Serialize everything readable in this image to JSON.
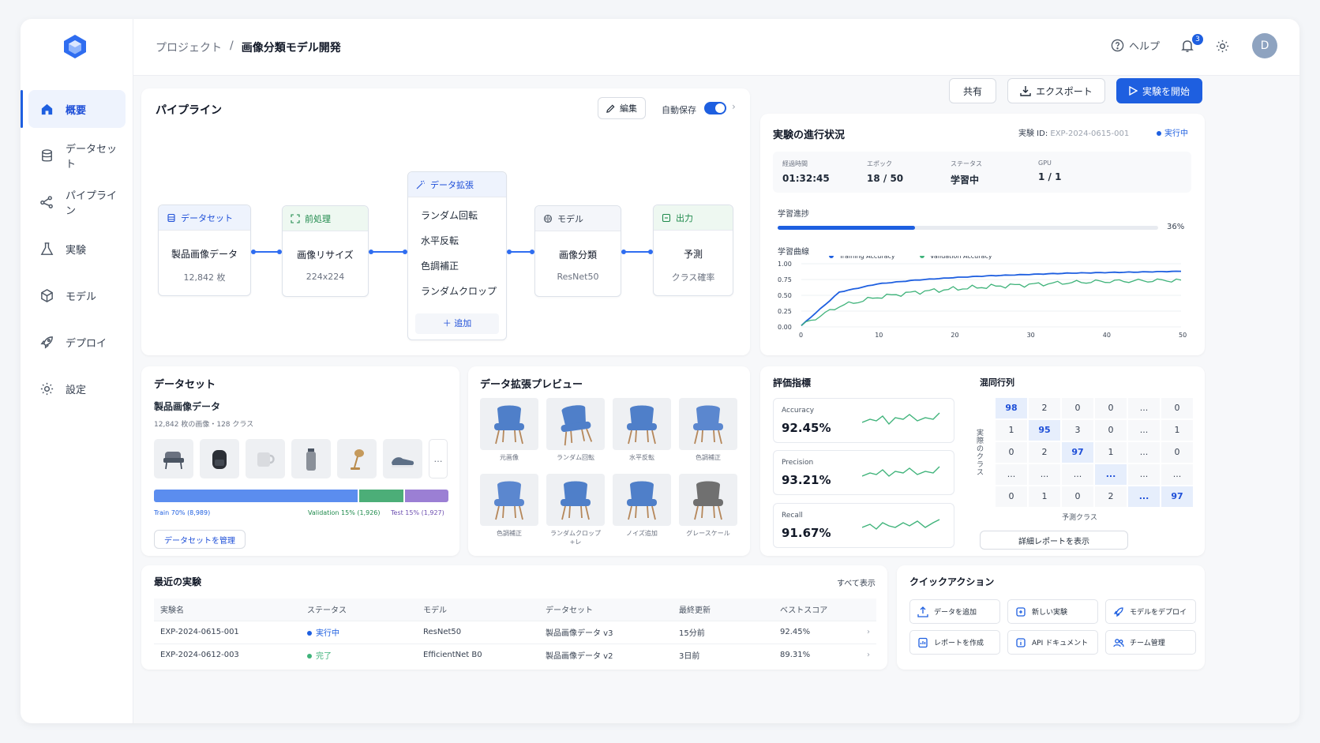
{
  "sidebar": {
    "items": [
      {
        "label": "概要"
      },
      {
        "label": "データセット"
      },
      {
        "label": "パイプライン"
      },
      {
        "label": "実験"
      },
      {
        "label": "モデル"
      },
      {
        "label": "デプロイ"
      },
      {
        "label": "設定"
      }
    ]
  },
  "header": {
    "breadcrumb_root": "プロジェクト",
    "breadcrumb_sep": "/",
    "breadcrumb_current": "画像分類モデル開発",
    "help": "ヘルプ",
    "notif_count": "3",
    "avatar": "D"
  },
  "actions": {
    "share": "共有",
    "export": "エクスポート",
    "start": "実験を開始"
  },
  "pipeline": {
    "title": "パイプライン",
    "edit": "編集",
    "autosave": "自動保存",
    "autosave_on": true,
    "nodes": {
      "dataset": {
        "head": "データセット",
        "title": "製品画像データ",
        "sub": "12,842 枚"
      },
      "preprocess": {
        "head": "前処理",
        "title": "画像リサイズ",
        "sub": "224x224"
      },
      "augment": {
        "head": "データ拡張",
        "items": [
          "ランダム回転",
          "水平反転",
          "色調補正",
          "ランダムクロップ"
        ],
        "add": "＋ 追加"
      },
      "model": {
        "head": "モデル",
        "title": "画像分類",
        "sub": "ResNet50"
      },
      "output": {
        "head": "出力",
        "title": "予測",
        "sub": "クラス確率"
      }
    }
  },
  "progress": {
    "title": "実験の進行状況",
    "exp_label": "実験 ID:",
    "exp_id": "EXP-2024-0615-001",
    "status": "実行中",
    "stats": [
      {
        "label": "経過時間",
        "value": "01:32:45"
      },
      {
        "label": "エポック",
        "value": "18 / 50"
      },
      {
        "label": "ステータス",
        "value": "学習中"
      },
      {
        "label": "GPU",
        "value": "1 / 1"
      }
    ],
    "progress_label": "学習進捗",
    "progress_pct": "36%",
    "progress_value": 0.36,
    "curve_label": "学習曲線"
  },
  "chart_data": {
    "type": "line",
    "x": [
      0,
      5,
      10,
      15,
      20,
      25,
      30,
      35,
      40,
      45,
      50
    ],
    "xlim": [
      0,
      50
    ],
    "ylim": [
      0,
      1
    ],
    "xticks": [
      "0",
      "10",
      "20",
      "30",
      "40",
      "50"
    ],
    "yticks": [
      "1.00",
      "0.75",
      "0.50",
      "0.25",
      "0.00"
    ],
    "series": [
      {
        "name": "Training Accuracy",
        "color": "#1e5fe0",
        "values": [
          0.02,
          0.55,
          0.68,
          0.74,
          0.78,
          0.81,
          0.83,
          0.85,
          0.86,
          0.87,
          0.88
        ]
      },
      {
        "name": "Validation Accuracy",
        "color": "#3fb37a",
        "values": [
          0.02,
          0.33,
          0.47,
          0.55,
          0.6,
          0.64,
          0.67,
          0.7,
          0.72,
          0.73,
          0.74
        ]
      }
    ]
  },
  "dataset": {
    "title": "データセット",
    "name": "製品画像データ",
    "meta": "12,842 枚の画像・128 クラス",
    "more": "…",
    "split": [
      {
        "label": "Train 70% (8,989)",
        "value": 0.7,
        "color": "#5b8def"
      },
      {
        "label": "Validation 15% (1,926)",
        "value": 0.15,
        "color": "#4cae78"
      },
      {
        "label": "Test 15% (1,927)",
        "value": 0.15,
        "color": "#9b7fd4"
      }
    ],
    "manage": "データセットを管理"
  },
  "augmentation": {
    "title": "データ拡張プレビュー",
    "items": [
      "元画像",
      "ランダム回転",
      "水平反転",
      "色調補正",
      "色調補正",
      "ランダムクロップ +レ",
      "ノイズ追加",
      "グレースケール"
    ]
  },
  "metrics": {
    "title": "評価指標",
    "items": [
      {
        "label": "Accuracy",
        "value": "92.45%"
      },
      {
        "label": "Precision",
        "value": "93.21%"
      },
      {
        "label": "Recall",
        "value": "91.67%"
      }
    ]
  },
  "confusion": {
    "title": "混同行列",
    "ylabel": "実際のクラス",
    "xlabel": "予測クラス",
    "report": "詳細レポートを表示",
    "rows": [
      [
        "98",
        "2",
        "0",
        "0",
        "...",
        "0"
      ],
      [
        "1",
        "95",
        "3",
        "0",
        "...",
        "1"
      ],
      [
        "0",
        "2",
        "97",
        "1",
        "...",
        "0"
      ],
      [
        "...",
        "...",
        "...",
        "...",
        "...",
        "..."
      ],
      [
        "0",
        "1",
        "0",
        "2",
        "...",
        "97"
      ]
    ]
  },
  "experiments": {
    "title": "最近の実験",
    "view_all": "すべて表示",
    "columns": [
      "実験名",
      "ステータス",
      "モデル",
      "データセット",
      "最終更新",
      "ベストスコア"
    ],
    "rows": [
      {
        "name": "EXP-2024-0615-001",
        "status": "実行中",
        "status_color": "#1e5fe0",
        "model": "ResNet50",
        "dataset": "製品画像データ v3",
        "updated": "15分前",
        "score": "92.45%"
      },
      {
        "name": "EXP-2024-0612-003",
        "status": "完了",
        "status_color": "#3fb37a",
        "model": "EfficientNet B0",
        "dataset": "製品画像データ v2",
        "updated": "3日前",
        "score": "89.31%"
      }
    ]
  },
  "quick": {
    "title": "クイックアクション",
    "items": [
      "データを追加",
      "新しい実験",
      "モデルをデプロイ",
      "レポートを作成",
      "API ドキュメント",
      "チーム管理"
    ]
  }
}
